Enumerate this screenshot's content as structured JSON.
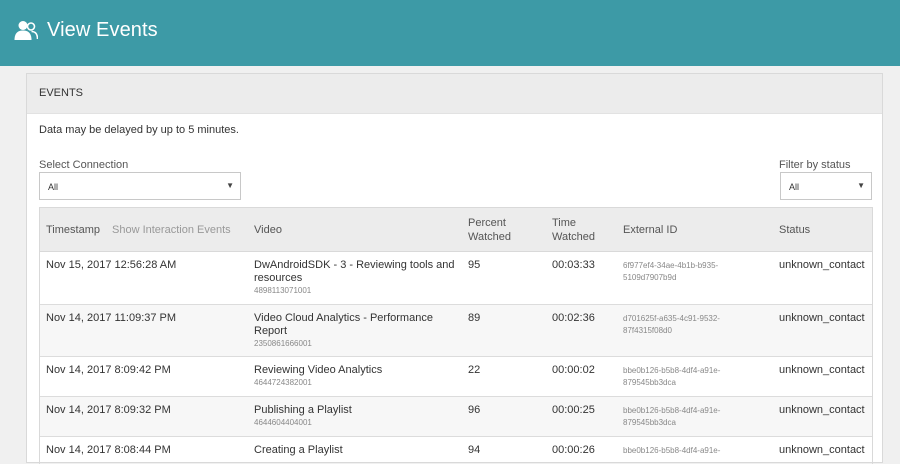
{
  "header": {
    "title": "View Events",
    "icon": "users-icon",
    "bg_color": "#3d9aa6"
  },
  "panel": {
    "heading": "EVENTS",
    "delay_notice": "Data may be delayed by up to 5 minutes."
  },
  "filters": {
    "connection": {
      "label": "Select Connection",
      "value": "All"
    },
    "status": {
      "label": "Filter by status",
      "value": "All"
    }
  },
  "table": {
    "columns": {
      "timestamp": "Timestamp",
      "show_interaction": "Show Interaction Events",
      "video": "Video",
      "percent_watched_1": "Percent",
      "percent_watched_2": "Watched",
      "time_watched_1": "Time",
      "time_watched_2": "Watched",
      "external_id": "External ID",
      "status": "Status"
    },
    "rows": [
      {
        "timestamp": "Nov 15, 2017 12:56:28 AM",
        "video_line1": "DwAndroidSDK - 3 - Reviewing tools and",
        "video_line2": "resources",
        "video_id": "4898113071001",
        "percent": "95",
        "time": "00:03:33",
        "ext_line1": "6f977ef4-34ae-4b1b-b935-",
        "ext_line2": "5109d7907b9d",
        "status": "unknown_contact"
      },
      {
        "timestamp": "Nov 14, 2017 11:09:37 PM",
        "video_line1": "Video Cloud Analytics - Performance",
        "video_line2": "Report",
        "video_id": "2350861666001",
        "percent": "89",
        "time": "00:02:36",
        "ext_line1": "d701625f-a635-4c91-9532-",
        "ext_line2": "87f4315f08d0",
        "status": "unknown_contact"
      },
      {
        "timestamp": "Nov 14, 2017 8:09:42 PM",
        "video_line1": "Reviewing Video Analytics",
        "video_id": "4644724382001",
        "percent": "22",
        "time": "00:00:02",
        "ext_line1": "bbe0b126-b5b8-4df4-a91e-",
        "ext_line2": "879545bb3dca",
        "status": "unknown_contact"
      },
      {
        "timestamp": "Nov 14, 2017 8:09:32 PM",
        "video_line1": "Publishing a Playlist",
        "video_id": "4644604404001",
        "percent": "96",
        "time": "00:00:25",
        "ext_line1": "bbe0b126-b5b8-4df4-a91e-",
        "ext_line2": "879545bb3dca",
        "status": "unknown_contact"
      },
      {
        "timestamp": "Nov 14, 2017 8:08:44 PM",
        "video_line1": "Creating a Playlist",
        "percent": "94",
        "time": "00:00:26",
        "ext_line1": "bbe0b126-b5b8-4df4-a91e-",
        "status": "unknown_contact"
      }
    ]
  }
}
